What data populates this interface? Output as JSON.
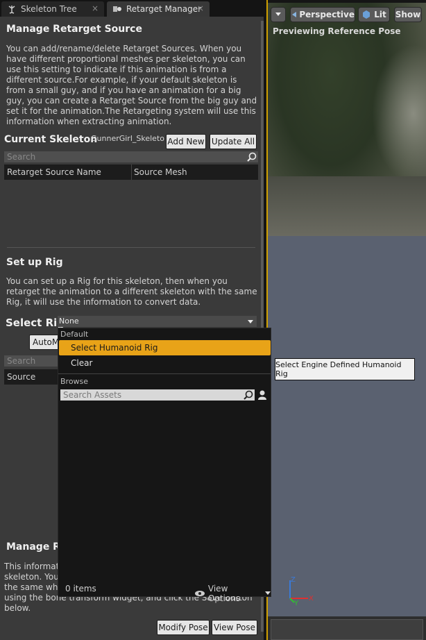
{
  "tabs": [
    {
      "label": "Skeleton Tree",
      "active": false
    },
    {
      "label": "Retarget Manager",
      "active": true
    }
  ],
  "retarget_source": {
    "heading": "Manage Retarget Source",
    "description": "You can add/rename/delete Retarget Sources. When you have different proportional meshes per skeleton, you can use this setting to indicate if this animation is from a different source.For example, if your default skeleton is from a small guy, and if you have an animation for a big guy, you can create a Retarget Source from the big guy and set it for the animation.The Retargeting system will use this information when extracting animation.",
    "current_skeleton_label": "Current Skeleton",
    "current_skeleton_name": "GunnerGirl_Skeleton",
    "add_new_label": "Add New",
    "update_all_label": "Update All",
    "search_placeholder": "Search",
    "columns": [
      "Retarget Source Name",
      "Source Mesh"
    ]
  },
  "rig": {
    "heading": "Set up Rig",
    "description": "You can set up a Rig for this skeleton, then when you retarget the animation to a different skeleton with the same Rig, it will use the information to convert data.",
    "select_rig_label": "Select Rig",
    "select_rig_value": "None",
    "auto_button_label": "AutoM",
    "search_placeholder": "Search",
    "source_column": "Source"
  },
  "pose": {
    "heading": "Manage Re",
    "description": "This informat\nskeleton. You\nthe same whe\nusing the bone transform widget, and click the Save button\nbelow.",
    "modify_pose_label": "Modify Pose",
    "view_pose_label": "View Pose"
  },
  "viewport": {
    "perspective_label": "Perspective",
    "lit_label": "Lit",
    "show_label": "Show",
    "status_text": "Previewing Reference Pose",
    "axis_x": "X",
    "axis_y": "Y",
    "axis_z": "Z"
  },
  "dropdown": {
    "default_section": "Default",
    "items": [
      "Select Humanoid Rig",
      "Clear"
    ],
    "browse_section": "Browse",
    "search_placeholder": "Search Assets",
    "item_count": "0 items",
    "view_options_label": "View Options"
  },
  "tooltip": {
    "text": "Select Engine Defined Humanoid Rig"
  },
  "colors": {
    "selected_item": "#e8a318",
    "viewport_border": "#d0a000"
  }
}
